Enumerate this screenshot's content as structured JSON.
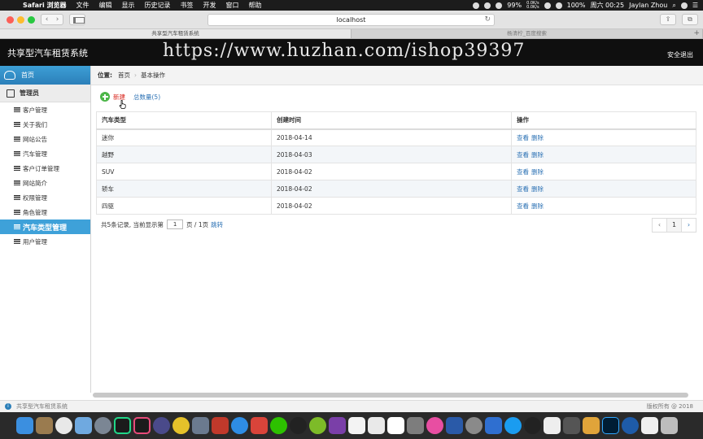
{
  "menubar": {
    "app": "Safari 浏览器",
    "items": [
      "文件",
      "编辑",
      "显示",
      "历史记录",
      "书签",
      "开发",
      "窗口",
      "帮助"
    ],
    "battery": "99%",
    "net_up": "0.0K/s",
    "net_down": "0.0K/s",
    "battery2": "100%",
    "time": "周六 00:25",
    "user": "Jaylan Zhou"
  },
  "browser": {
    "url": "localhost",
    "tabs": [
      "共享型汽车租赁系统",
      "杨清柠_百度搜索"
    ]
  },
  "app": {
    "title": "共享型汽车租赁系统",
    "watermark": "https://www.huzhan.com/ishop39397",
    "logout": "安全退出"
  },
  "sidebar": {
    "home": "首页",
    "group": "管理员",
    "items": [
      {
        "label": "客户管理"
      },
      {
        "label": "关于我们"
      },
      {
        "label": "网站公告"
      },
      {
        "label": "汽车管理"
      },
      {
        "label": "客户订单管理"
      },
      {
        "label": "网站简介"
      },
      {
        "label": "权限管理"
      },
      {
        "label": "角色管理"
      },
      {
        "label": "汽车类型管理"
      },
      {
        "label": "用户管理"
      }
    ]
  },
  "breadcrumb": {
    "prefix": "位置:",
    "home": "首页",
    "current": "基本操作"
  },
  "actions": {
    "add": "新建",
    "total": "总数量(5)"
  },
  "table": {
    "headers": [
      "汽车类型",
      "创建时间",
      "操作"
    ],
    "rows": [
      {
        "type": "迷你",
        "created": "2018-04-14"
      },
      {
        "type": "越野",
        "created": "2018-04-03"
      },
      {
        "type": "SUV",
        "created": "2018-04-02"
      },
      {
        "type": "轿车",
        "created": "2018-04-02"
      },
      {
        "type": "四驱",
        "created": "2018-04-02"
      }
    ],
    "view_label": "查看",
    "delete_label": "删除"
  },
  "pager": {
    "text_before": "共5条记录, 当前显示第",
    "page_value": "1",
    "text_after": "页 / 1页",
    "jump": "跳转",
    "prev": "‹",
    "current": "1",
    "next": "›"
  },
  "footer": {
    "left": "共享型汽车租赁系统",
    "right": "版权所有 @ 2018"
  },
  "colors": {
    "accent": "#3ea1d9",
    "link": "#2e73b5",
    "add_green": "#4cb648",
    "add_red": "#d9281f"
  }
}
